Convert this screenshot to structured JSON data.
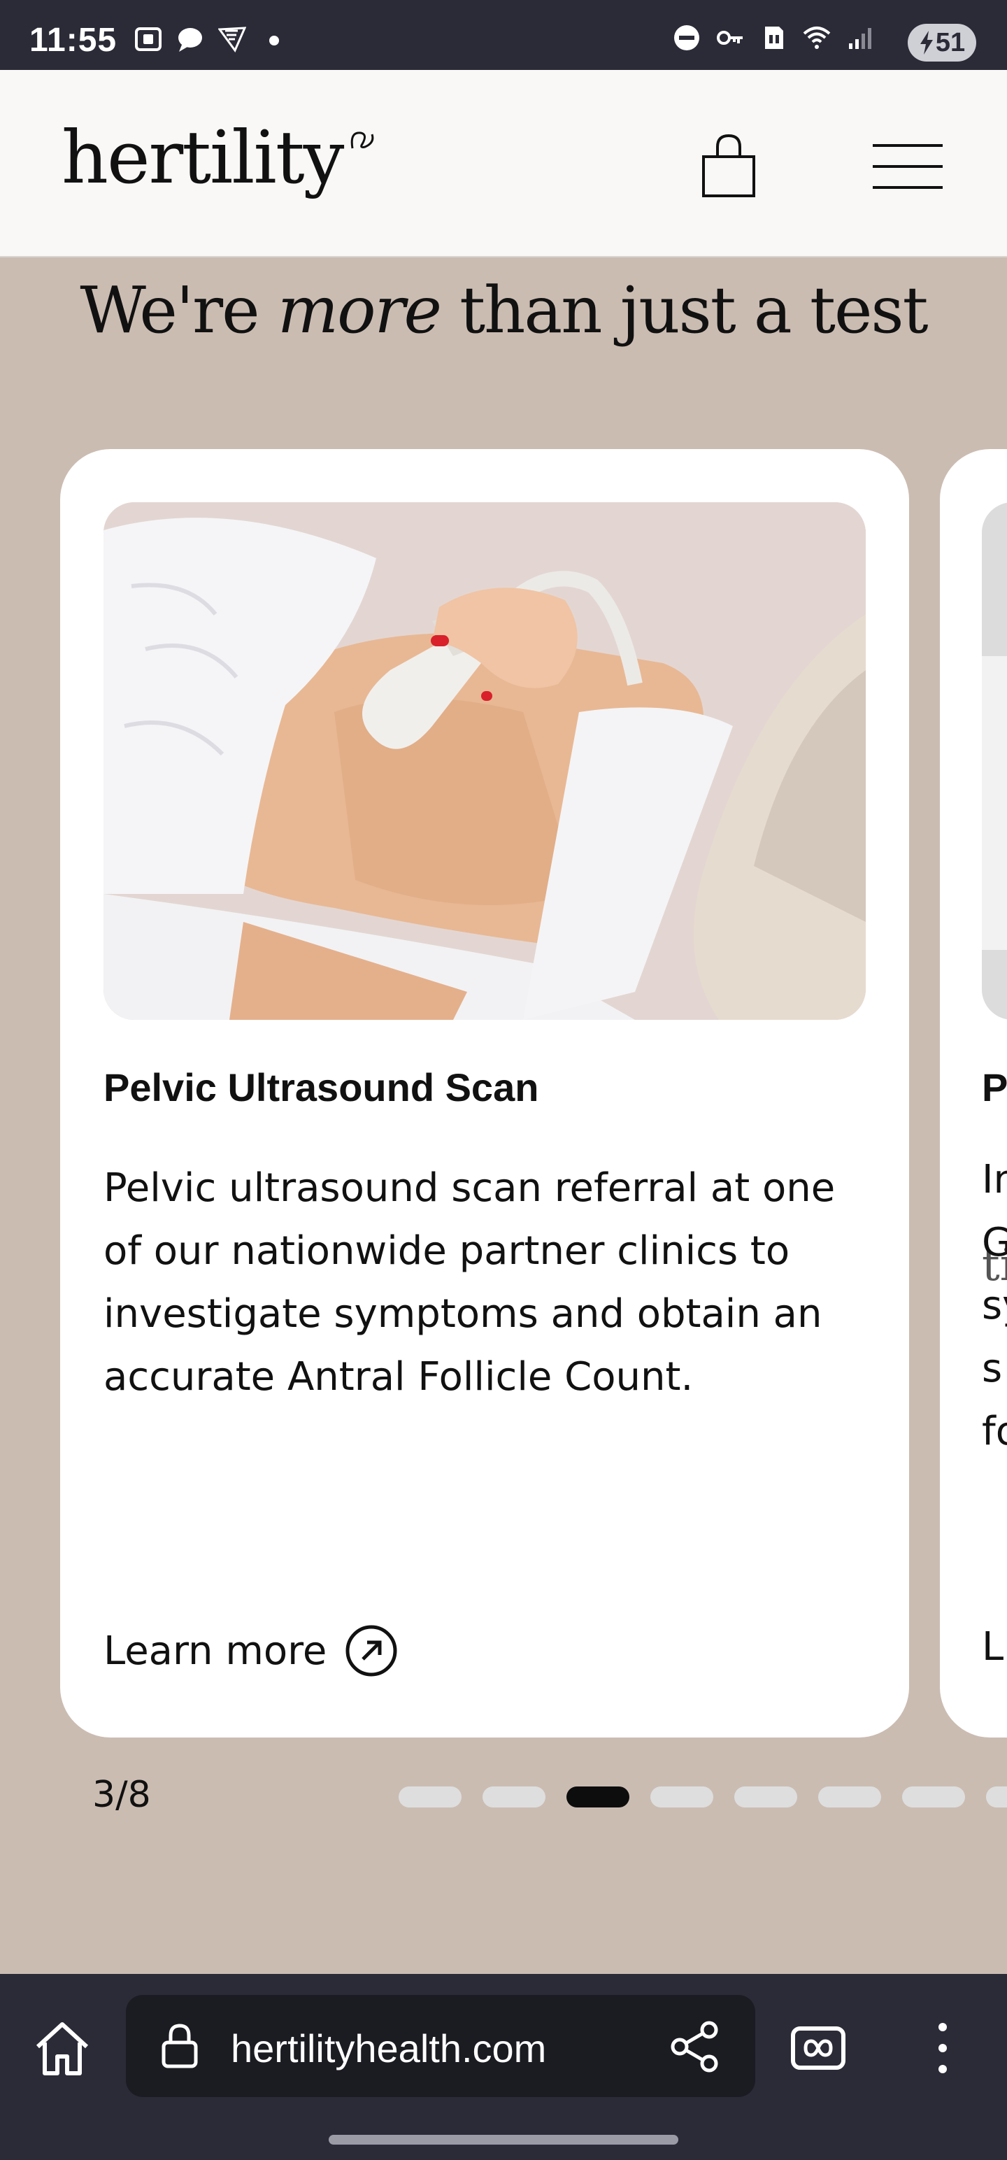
{
  "status_bar": {
    "time": "11:55",
    "battery_level": "51",
    "left_icons": [
      "screenshot-icon",
      "chat-bubble-icon",
      "ryanair-icon",
      "dot-icon"
    ],
    "right_icons": [
      "dnd-icon",
      "vpn-key-icon",
      "sim-icon",
      "wifi-icon",
      "signal-icon"
    ]
  },
  "header": {
    "logo": "hertility",
    "icons": [
      "shopping-bag-icon",
      "hamburger-menu-icon"
    ]
  },
  "section": {
    "title_before": "We're ",
    "title_italic": "more",
    "title_after": " than just a test"
  },
  "cards": [
    {
      "title": "Pelvic Ultrasound Scan",
      "description": "Pelvic ultrasound scan referral at one of our nationwide partner clinics to investigate symptoms and obtain an accurate Antral Follicle Count.",
      "link_label": "Learn more"
    },
    {
      "title_fragment": "P",
      "desc_fragments": [
        "In",
        "G",
        "sy",
        "s",
        "fo"
      ],
      "link_fragment": "L",
      "image_text_fragment": "ti"
    }
  ],
  "carousel": {
    "counter": "3/8",
    "current": 3,
    "total": 8
  },
  "browser": {
    "url": "hertilityhealth.com",
    "icons": [
      "home-icon",
      "lock-icon",
      "share-icon",
      "tabs-icon",
      "more-icon"
    ]
  },
  "colors": {
    "background": "#cbbcb2",
    "header_bg": "#f9f8f6",
    "card_bg": "#ffffff",
    "system_bar": "#2b2b38",
    "dot_active": "#0d0d0d",
    "dot_inactive": "#dedede"
  }
}
